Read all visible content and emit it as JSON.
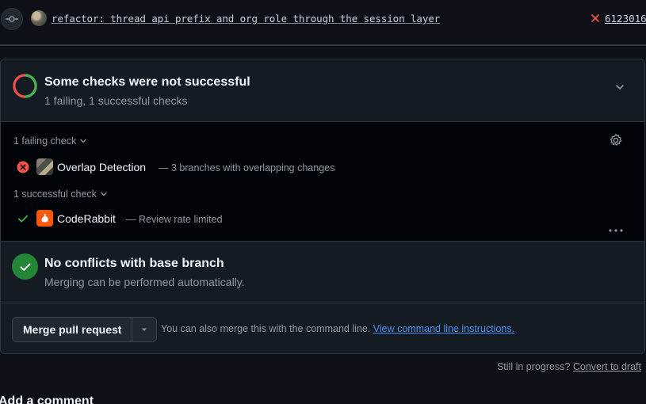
{
  "commit": {
    "message": "refactor: thread api prefix and org role through the session layer",
    "sha": "6123016",
    "status": "failed"
  },
  "checks": {
    "title": "Some checks were not successful",
    "summary": "1 failing, 1 successful checks",
    "failing_group_label": "1 failing check",
    "successful_group_label": "1 successful check",
    "failing": [
      {
        "name": "Overlap Detection",
        "description": "— 3 branches with overlapping changes"
      }
    ],
    "successful": [
      {
        "name": "CodeRabbit",
        "description": "— Review rate limited"
      }
    ]
  },
  "conflicts": {
    "title": "No conflicts with base branch",
    "subtitle": "Merging can be performed automatically."
  },
  "merge": {
    "button_label": "Merge pull request",
    "hint_text": "You can also merge this with the command line.",
    "hint_link": "View command line instructions."
  },
  "draft": {
    "prompt": "Still in progress?",
    "link": "Convert to draft"
  },
  "comment": {
    "heading": "Add a comment"
  },
  "colors": {
    "fail": "#f85149",
    "success": "#3fb950",
    "success_bg": "#238636",
    "link": "#4493f8",
    "coderabbit": "#ff570a"
  }
}
